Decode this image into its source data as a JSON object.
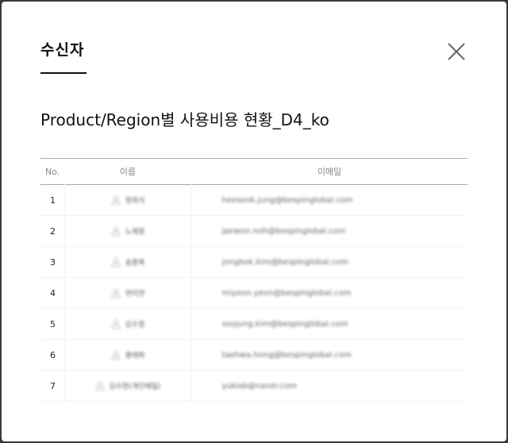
{
  "dialog": {
    "tab_label": "수신자",
    "report_title": "Product/Region별 사용비용 현황_D4_ko"
  },
  "table": {
    "columns": {
      "no": "No.",
      "name": "이름",
      "email": "이메일"
    },
    "rows": [
      {
        "no": "1",
        "name": "정희석",
        "email": "heeseok.jung@bespinglobal.com"
      },
      {
        "no": "2",
        "name": "노재원",
        "email": "jaewon.noh@bespinglobal.com"
      },
      {
        "no": "3",
        "name": "송종복",
        "email": "jongbok.kim@bespinglobal.com"
      },
      {
        "no": "4",
        "name": "연미연",
        "email": "miyeon.yeon@bespinglobal.com"
      },
      {
        "no": "5",
        "name": "김수정",
        "email": "soojung.kim@bespinglobal.com"
      },
      {
        "no": "6",
        "name": "홍태화",
        "email": "taehwa.hong@bespinglobal.com"
      },
      {
        "no": "7",
        "name": "김수현(개인메일)",
        "email": "yukisb@naver.com"
      }
    ]
  },
  "icons": {
    "close": "close-icon",
    "person": "person-icon"
  },
  "colors": {
    "text": "#111111",
    "muted": "#888888",
    "border": "#aaaaaa",
    "backdrop": "#3a3a3a"
  }
}
